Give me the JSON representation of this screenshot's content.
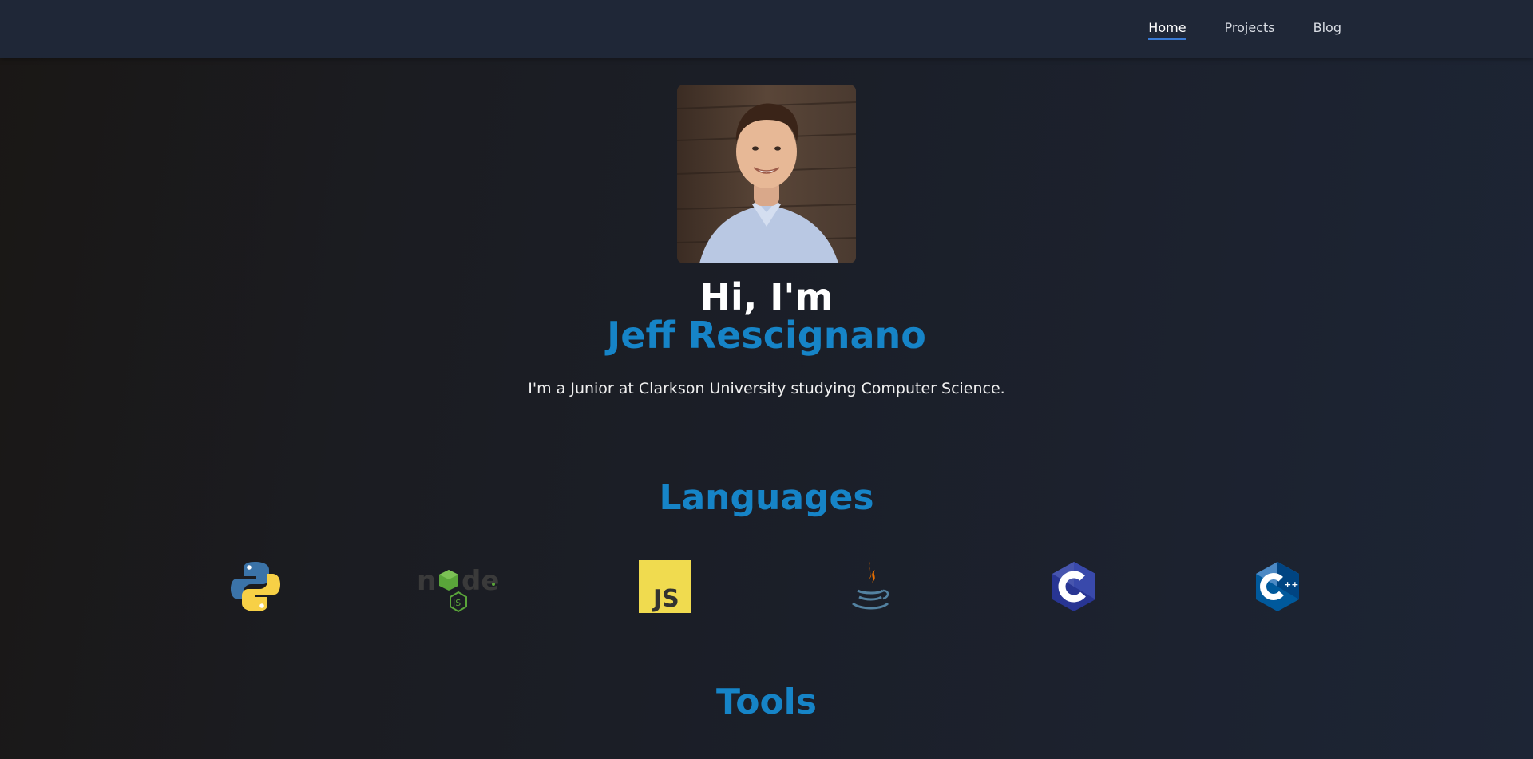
{
  "nav": {
    "items": [
      {
        "label": "Home",
        "active": true
      },
      {
        "label": "Projects",
        "active": false
      },
      {
        "label": "Blog",
        "active": false
      }
    ]
  },
  "hero": {
    "greeting": "Hi, I'm",
    "name": "Jeff Rescignano",
    "subtitle": "I'm a Junior at Clarkson University studying Computer Science.",
    "photo_icon": "profile-photo"
  },
  "languages": {
    "title": "Languages",
    "items": [
      {
        "name": "python-icon"
      },
      {
        "name": "nodejs-icon"
      },
      {
        "name": "javascript-icon"
      },
      {
        "name": "java-icon"
      },
      {
        "name": "c-icon"
      },
      {
        "name": "cpp-icon"
      }
    ]
  },
  "tools": {
    "title": "Tools"
  },
  "colors": {
    "accent": "#1684c7",
    "navbar": "#1f2737",
    "active_underline": "#3a7bd5"
  }
}
